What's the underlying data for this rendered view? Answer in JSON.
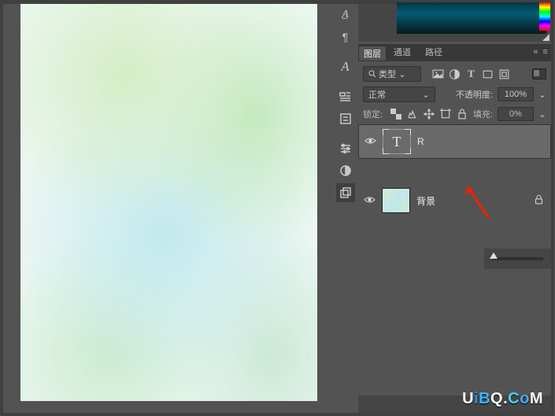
{
  "panel": {
    "tabs": [
      "图层",
      "通道",
      "路径"
    ],
    "filter_kind": "类型",
    "blend_mode": "正常",
    "opacity_label": "不透明度:",
    "opacity_value": "100%",
    "lock_label": "锁定:",
    "fill_label": "填充:",
    "fill_value": "0%"
  },
  "layers": [
    {
      "name": "R",
      "type": "text",
      "visible": true,
      "selected": true,
      "locked": false
    },
    {
      "name": "背景",
      "type": "bg",
      "visible": true,
      "selected": false,
      "locked": true
    }
  ],
  "watermark": "UiBQ.CoM"
}
